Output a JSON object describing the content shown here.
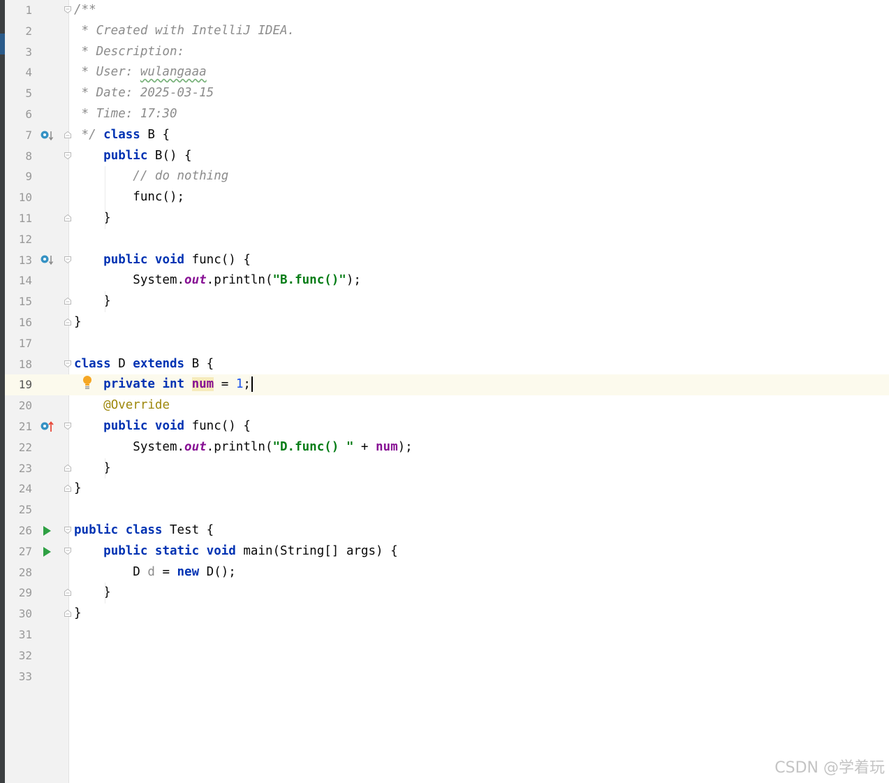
{
  "editor": {
    "language": "Java",
    "current_line": 19,
    "lines": [
      {
        "n": "1",
        "tokens": [
          [
            "cmt",
            "/**"
          ]
        ]
      },
      {
        "n": "2",
        "tokens": [
          [
            "cmt",
            " * Created with IntelliJ IDEA."
          ]
        ]
      },
      {
        "n": "3",
        "tokens": [
          [
            "cmt",
            " * Description:"
          ]
        ]
      },
      {
        "n": "4",
        "tokens": [
          [
            "cmt",
            " * User: "
          ],
          [
            "cmt-wavy",
            "wulangaaa"
          ]
        ]
      },
      {
        "n": "5",
        "tokens": [
          [
            "cmt",
            " * Date: 2025-03-15"
          ]
        ]
      },
      {
        "n": "6",
        "tokens": [
          [
            "cmt",
            " * Time: 17:30"
          ]
        ]
      },
      {
        "n": "7",
        "tokens": [
          [
            "cmt",
            " */ "
          ],
          [
            "kw",
            "class"
          ],
          [
            "plain",
            " B {"
          ]
        ]
      },
      {
        "n": "8",
        "tokens": [
          [
            "plain",
            "    "
          ],
          [
            "kw",
            "public"
          ],
          [
            "plain",
            " B() {"
          ]
        ]
      },
      {
        "n": "9",
        "tokens": [
          [
            "plain",
            "        "
          ],
          [
            "cmt",
            "// do nothing"
          ]
        ]
      },
      {
        "n": "10",
        "tokens": [
          [
            "plain",
            "        func();"
          ]
        ]
      },
      {
        "n": "11",
        "tokens": [
          [
            "plain",
            "    }"
          ]
        ]
      },
      {
        "n": "12",
        "tokens": []
      },
      {
        "n": "13",
        "tokens": [
          [
            "plain",
            "    "
          ],
          [
            "kw",
            "public void"
          ],
          [
            "plain",
            " func() {"
          ]
        ]
      },
      {
        "n": "14",
        "tokens": [
          [
            "plain",
            "        System."
          ],
          [
            "stat",
            "out"
          ],
          [
            "plain",
            ".println("
          ],
          [
            "str",
            "\"B.func()\""
          ],
          [
            "plain",
            ");"
          ]
        ]
      },
      {
        "n": "15",
        "tokens": [
          [
            "plain",
            "    }"
          ]
        ]
      },
      {
        "n": "16",
        "tokens": [
          [
            "plain",
            "}"
          ]
        ]
      },
      {
        "n": "17",
        "tokens": []
      },
      {
        "n": "18",
        "tokens": [
          [
            "kw",
            "class"
          ],
          [
            "plain",
            " D "
          ],
          [
            "kw",
            "extends"
          ],
          [
            "plain",
            " B {"
          ]
        ]
      },
      {
        "n": "19",
        "tokens": [
          [
            "plain",
            "    "
          ],
          [
            "kw",
            "private int"
          ],
          [
            "plain",
            " "
          ],
          [
            "fld-hl",
            "num"
          ],
          [
            "plain",
            " = "
          ],
          [
            "num",
            "1"
          ],
          [
            "plain",
            ";"
          ],
          [
            "caret",
            ""
          ]
        ]
      },
      {
        "n": "20",
        "tokens": [
          [
            "plain",
            "    "
          ],
          [
            "ann",
            "@Override"
          ]
        ]
      },
      {
        "n": "21",
        "tokens": [
          [
            "plain",
            "    "
          ],
          [
            "kw",
            "public void"
          ],
          [
            "plain",
            " func() {"
          ]
        ]
      },
      {
        "n": "22",
        "tokens": [
          [
            "plain",
            "        System."
          ],
          [
            "stat",
            "out"
          ],
          [
            "plain",
            ".println("
          ],
          [
            "str",
            "\"D.func() \""
          ],
          [
            "plain",
            " + "
          ],
          [
            "fld",
            "num"
          ],
          [
            "plain",
            ");"
          ]
        ]
      },
      {
        "n": "23",
        "tokens": [
          [
            "plain",
            "    }"
          ]
        ]
      },
      {
        "n": "24",
        "tokens": [
          [
            "plain",
            "}"
          ]
        ]
      },
      {
        "n": "25",
        "tokens": []
      },
      {
        "n": "26",
        "tokens": [
          [
            "kw",
            "public class"
          ],
          [
            "plain",
            " Test {"
          ]
        ]
      },
      {
        "n": "27",
        "tokens": [
          [
            "plain",
            "    "
          ],
          [
            "kw",
            "public static void"
          ],
          [
            "plain",
            " main(String[] args) {"
          ]
        ]
      },
      {
        "n": "28",
        "tokens": [
          [
            "plain",
            "        D "
          ],
          [
            "unused",
            "d"
          ],
          [
            "plain",
            " = "
          ],
          [
            "kw",
            "new"
          ],
          [
            "plain",
            " D();"
          ]
        ]
      },
      {
        "n": "29",
        "tokens": [
          [
            "plain",
            "    }"
          ]
        ]
      },
      {
        "n": "30",
        "tokens": [
          [
            "plain",
            "}"
          ]
        ]
      },
      {
        "n": "31",
        "tokens": []
      },
      {
        "n": "32",
        "tokens": []
      },
      {
        "n": "33",
        "tokens": []
      }
    ],
    "gutter_icons": [
      {
        "line": 7,
        "icon": "overridden-down-icon"
      },
      {
        "line": 13,
        "icon": "overridden-down-icon"
      },
      {
        "line": 19,
        "icon": "lightbulb-icon"
      },
      {
        "line": 21,
        "icon": "overriding-up-icon"
      },
      {
        "line": 26,
        "icon": "run-icon"
      },
      {
        "line": 27,
        "icon": "run-icon"
      }
    ],
    "fold_markers": [
      {
        "line": 1,
        "type": "open"
      },
      {
        "line": 7,
        "type": "close"
      },
      {
        "line": 8,
        "type": "open"
      },
      {
        "line": 11,
        "type": "close"
      },
      {
        "line": 13,
        "type": "open"
      },
      {
        "line": 15,
        "type": "close"
      },
      {
        "line": 16,
        "type": "close"
      },
      {
        "line": 18,
        "type": "open"
      },
      {
        "line": 21,
        "type": "open"
      },
      {
        "line": 23,
        "type": "close"
      },
      {
        "line": 24,
        "type": "close"
      },
      {
        "line": 26,
        "type": "open"
      },
      {
        "line": 27,
        "type": "open"
      },
      {
        "line": 29,
        "type": "close"
      },
      {
        "line": 30,
        "type": "close"
      }
    ]
  },
  "colors": {
    "keyword": "#0033b3",
    "comment": "#8c8c8c",
    "string": "#067d17",
    "number": "#1750eb",
    "field": "#871094",
    "annotation": "#9e880d",
    "current_line": "#fcfaed",
    "run_icon": "#2ea043",
    "override_icon": "#3592c4",
    "override_up_arrow": "#e84c3d",
    "lightbulb": "#f5a623"
  },
  "watermark": "CSDN @学着玩"
}
